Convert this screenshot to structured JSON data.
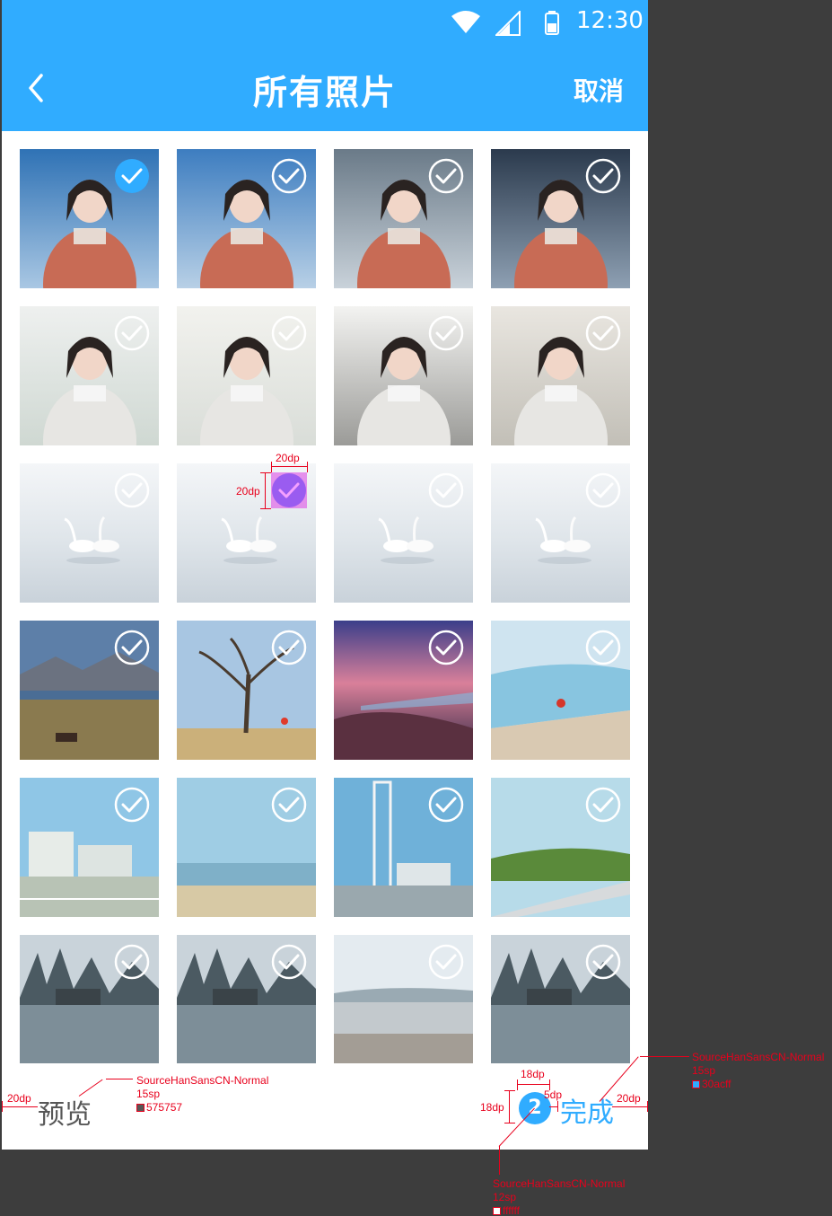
{
  "status_bar": {
    "time": "12:30"
  },
  "header": {
    "title": "所有照片",
    "cancel_label": "取消"
  },
  "photos": {
    "count": 24,
    "highlighted_index": 9,
    "scenes": [
      "portrait",
      "portrait",
      "portrait",
      "portrait",
      "portrait",
      "portrait",
      "portrait",
      "portrait",
      "swan",
      "swan",
      "swan",
      "swan",
      "landscape",
      "tree",
      "sunset",
      "coast",
      "town",
      "sea",
      "tower",
      "road",
      "winter",
      "winter",
      "lake",
      "winter"
    ]
  },
  "bottom_bar": {
    "preview_label": "预览",
    "selected_count": "2",
    "done_label": "完成"
  },
  "annotations": {
    "check_width": "20dp",
    "check_height": "20dp",
    "preview_margin": "20dp",
    "preview_font": "SourceHanSansCN-Normal",
    "preview_size": "15sp",
    "preview_color": "575757",
    "badge_width": "18dp",
    "badge_height": "18dp",
    "badge_gap": "5dp",
    "done_margin": "20dp",
    "done_font": "SourceHanSansCN-Normal",
    "done_size": "15sp",
    "done_color": "30acff",
    "badge_font": "SourceHanSansCN-Normal",
    "badge_size": "12sp",
    "badge_color": "ffffff"
  },
  "colors": {
    "accent": "#30acff",
    "secondary_text": "#575757",
    "check_highlight": "#9a5cf0"
  }
}
